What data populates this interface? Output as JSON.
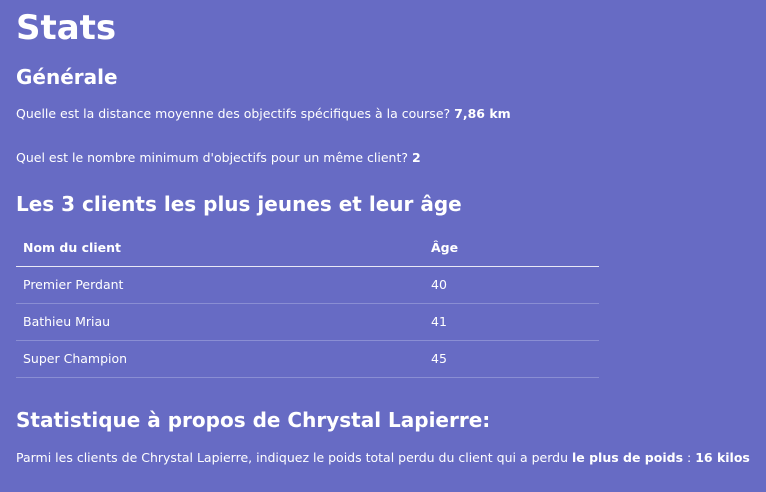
{
  "title": "Stats",
  "generale": {
    "heading": "Générale",
    "q1": {
      "text": "Quelle est la distance moyenne des objectifs spécifiques à la course?",
      "value": "7,86 km"
    },
    "q2": {
      "text": "Quel est le nombre minimum d'objectifs pour un même client?",
      "value": "2"
    }
  },
  "youngest": {
    "heading": "Les 3 clients les plus jeunes et leur âge",
    "columns": [
      "Nom du client",
      "Âge"
    ],
    "rows": [
      {
        "name": "Premier Perdant",
        "age": "40"
      },
      {
        "name": "Bathieu Mriau",
        "age": "41"
      },
      {
        "name": "Super Champion",
        "age": "45"
      }
    ]
  },
  "stat_lapierre": {
    "heading": "Statistique à propos de Chrystal Lapierre:",
    "text_before": "Parmi les clients de Chrystal Lapierre, indiquez le poids total perdu du client qui a perdu",
    "emphasis": "le plus de poids",
    "separator": ":",
    "value": "16 kilos"
  }
}
